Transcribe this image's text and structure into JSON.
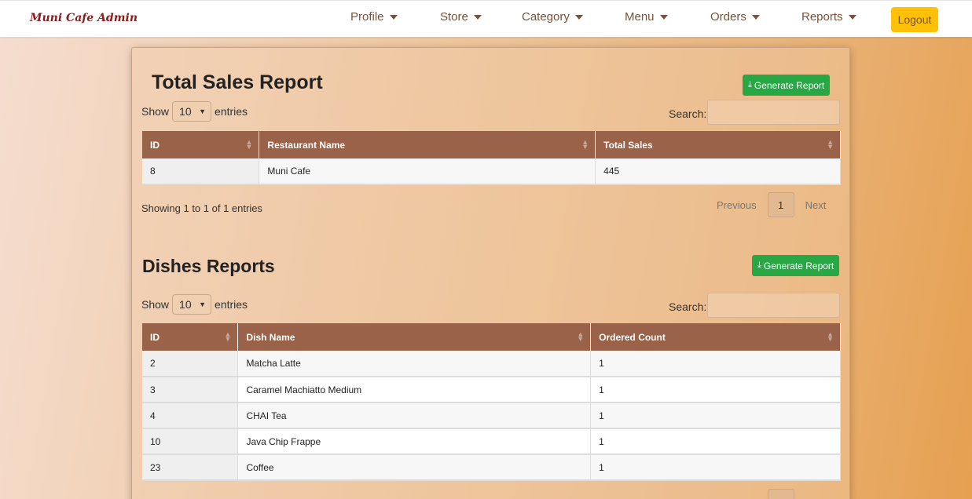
{
  "nav": {
    "brand": "Muni Cafe Admin",
    "items": [
      {
        "label": "Profile"
      },
      {
        "label": "Store"
      },
      {
        "label": "Category"
      },
      {
        "label": "Menu"
      },
      {
        "label": "Orders"
      },
      {
        "label": "Reports"
      }
    ],
    "logout": "Logout"
  },
  "sales": {
    "title": "Total Sales Report",
    "generate": "Generate Report",
    "show": "Show",
    "entries_value": "10",
    "entries": "entries",
    "search_label": "Search:",
    "search_value": "",
    "columns": [
      "ID",
      "Restaurant Name",
      "Total Sales"
    ],
    "rows": [
      [
        "8",
        "Muni Cafe",
        "445"
      ]
    ],
    "info": "Showing 1 to 1 of 1 entries",
    "previous": "Previous",
    "page": "1",
    "next": "Next"
  },
  "dishes": {
    "title": "Dishes Reports",
    "generate": "Generate Report",
    "show": "Show",
    "entries_value": "10",
    "entries": "entries",
    "search_label": "Search:",
    "search_value": "",
    "columns": [
      "ID",
      "Dish Name",
      "Ordered Count"
    ],
    "rows": [
      [
        "2",
        "Matcha Latte",
        "1"
      ],
      [
        "3",
        "Caramel Machiatto Medium",
        "1"
      ],
      [
        "4",
        "CHAI Tea",
        "1"
      ],
      [
        "10",
        "Java Chip Frappe",
        "1"
      ],
      [
        "23",
        "Coffee",
        "1"
      ]
    ]
  },
  "colors": {
    "header_bg": "#9a6249",
    "generate_btn": "#28a745",
    "logout_btn": "#ffc107",
    "brand": "#8b1c1c"
  }
}
